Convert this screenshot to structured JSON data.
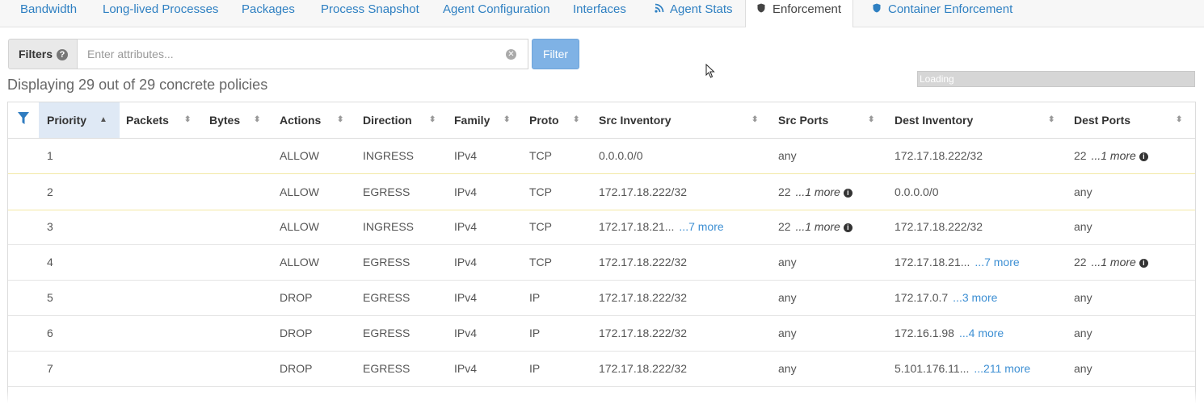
{
  "tabs": [
    {
      "label": "Bandwidth",
      "icon": ""
    },
    {
      "label": "Long-lived Processes",
      "icon": ""
    },
    {
      "label": "Packages",
      "icon": ""
    },
    {
      "label": "Process Snapshot",
      "icon": ""
    },
    {
      "label": "Agent Configuration",
      "icon": ""
    },
    {
      "label": "Interfaces",
      "icon": ""
    },
    {
      "label": "Agent Stats",
      "icon": "rss-icon"
    },
    {
      "label": "Enforcement",
      "icon": "shield-icon",
      "active": true
    },
    {
      "label": "Container Enforcement",
      "icon": "shield-icon"
    }
  ],
  "filters": {
    "label": "Filters",
    "placeholder": "Enter attributes...",
    "button": "Filter"
  },
  "loading": "Loading",
  "display_info": "Displaying 29 out of 29 concrete policies",
  "columns": [
    "Priority",
    "Packets",
    "Bytes",
    "Actions",
    "Direction",
    "Family",
    "Proto",
    "Src Inventory",
    "Src Ports",
    "Dest Inventory",
    "Dest Ports"
  ],
  "sorted_column": "Priority",
  "rows": [
    {
      "priority": "1",
      "action": "ALLOW",
      "direction": "INGRESS",
      "family": "IPv4",
      "proto": "TCP",
      "src_inv": "0.0.0.0/0",
      "src_inv_more": "",
      "src_ports": "any",
      "src_ports_more": "",
      "dest_inv": "172.17.18.222/32",
      "dest_inv_more": "",
      "dest_ports": "22",
      "dest_ports_more": "...1 more"
    },
    {
      "priority": "2",
      "action": "ALLOW",
      "direction": "EGRESS",
      "family": "IPv4",
      "proto": "TCP",
      "src_inv": "172.17.18.222/32",
      "src_inv_more": "",
      "src_ports": "22",
      "src_ports_more": "...1 more",
      "dest_inv": "0.0.0.0/0",
      "dest_inv_more": "",
      "dest_ports": "any",
      "dest_ports_more": ""
    },
    {
      "priority": "3",
      "action": "ALLOW",
      "direction": "INGRESS",
      "family": "IPv4",
      "proto": "TCP",
      "src_inv": "172.17.18.21...",
      "src_inv_more": "...7 more",
      "src_ports": "22",
      "src_ports_more": "...1 more",
      "dest_inv": "172.17.18.222/32",
      "dest_inv_more": "",
      "dest_ports": "any",
      "dest_ports_more": ""
    },
    {
      "priority": "4",
      "action": "ALLOW",
      "direction": "EGRESS",
      "family": "IPv4",
      "proto": "TCP",
      "src_inv": "172.17.18.222/32",
      "src_inv_more": "",
      "src_ports": "any",
      "src_ports_more": "",
      "dest_inv": "172.17.18.21...",
      "dest_inv_more": "...7 more",
      "dest_ports": "22",
      "dest_ports_more": "...1 more"
    },
    {
      "priority": "5",
      "action": "DROP",
      "direction": "EGRESS",
      "family": "IPv4",
      "proto": "IP",
      "src_inv": "172.17.18.222/32",
      "src_inv_more": "",
      "src_ports": "any",
      "src_ports_more": "",
      "dest_inv": "172.17.0.7",
      "dest_inv_more": "...3 more",
      "dest_ports": "any",
      "dest_ports_more": ""
    },
    {
      "priority": "6",
      "action": "DROP",
      "direction": "EGRESS",
      "family": "IPv4",
      "proto": "IP",
      "src_inv": "172.17.18.222/32",
      "src_inv_more": "",
      "src_ports": "any",
      "src_ports_more": "",
      "dest_inv": "172.16.1.98",
      "dest_inv_more": "...4 more",
      "dest_ports": "any",
      "dest_ports_more": ""
    },
    {
      "priority": "7",
      "action": "DROP",
      "direction": "EGRESS",
      "family": "IPv4",
      "proto": "IP",
      "src_inv": "172.17.18.222/32",
      "src_inv_more": "",
      "src_ports": "any",
      "src_ports_more": "",
      "dest_inv": "5.101.176.11...",
      "dest_inv_more": "...211 more",
      "dest_ports": "any",
      "dest_ports_more": ""
    }
  ]
}
